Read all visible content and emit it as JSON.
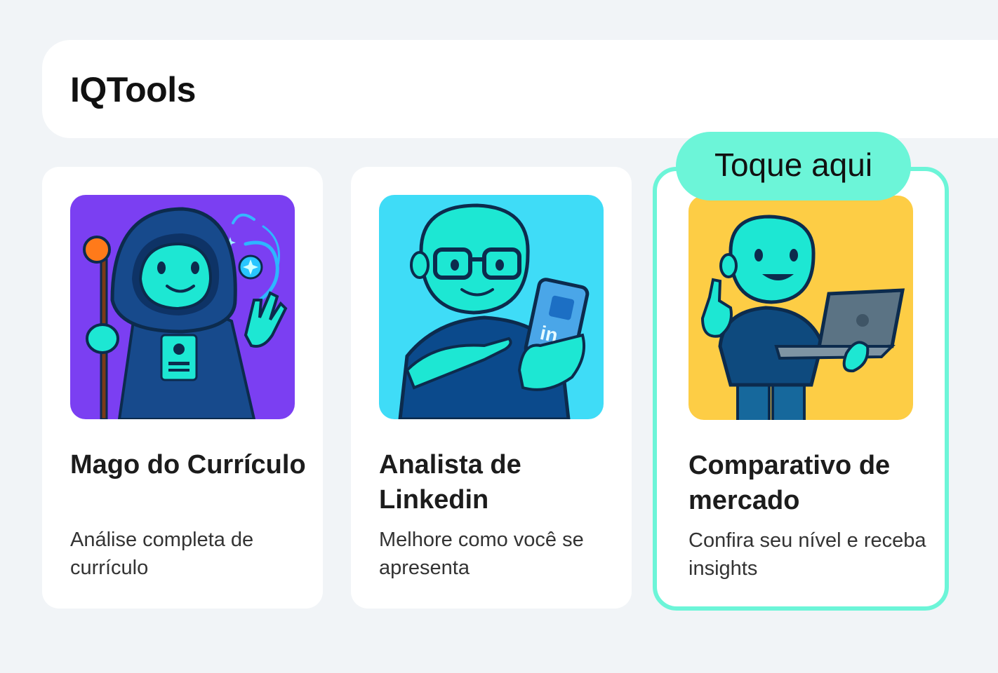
{
  "header": {
    "title": "IQTools"
  },
  "tooltip": {
    "label": "Toque aqui"
  },
  "cards": [
    {
      "title": "Mago do Currículo",
      "description": "Análise completa de currículo",
      "bg_color": "#7b3ff2"
    },
    {
      "title": "Analista de Linkedin",
      "description": "Melhore como você se apresenta",
      "bg_color": "#3fdcf7"
    },
    {
      "title": "Comparativo de mercado",
      "description": "Confira seu nível e receba insights",
      "bg_color": "#fdcd45"
    }
  ],
  "colors": {
    "page_bg": "#f1f4f7",
    "accent": "#6cf5d8",
    "character": "#1de7d3",
    "outline": "#0c2b4d"
  }
}
